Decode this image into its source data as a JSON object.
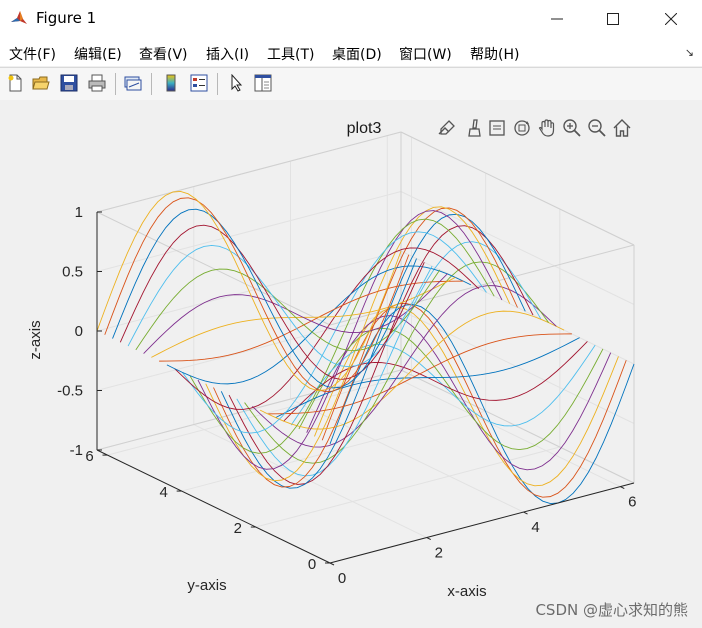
{
  "window": {
    "title": "Figure 1",
    "minimize_icon": "minimize-icon",
    "maximize_icon": "maximize-icon",
    "close_icon": "close-icon"
  },
  "menu": {
    "items": [
      "文件(F)",
      "编辑(E)",
      "查看(V)",
      "插入(I)",
      "工具(T)",
      "桌面(D)",
      "窗口(W)",
      "帮助(H)"
    ]
  },
  "toolbar": {
    "icons": [
      "new-figure-icon",
      "open-file-icon",
      "save-icon",
      "print-icon",
      "link-plot-icon",
      "colorbar-icon",
      "legend-icon",
      "select-arrow-icon",
      "property-editor-icon"
    ]
  },
  "axes_toolbar": {
    "icons": [
      "data-tips-icon",
      "brush-icon",
      "export-icon",
      "rotate-3d-icon",
      "pan-icon",
      "zoom-in-icon",
      "zoom-out-icon",
      "home-icon"
    ]
  },
  "chart_data": {
    "type": "line",
    "title": "plot3",
    "xlabel": "x-axis",
    "ylabel": "y-axis",
    "zlabel": "z-axis",
    "function": "z = sin(x)·cos(y)",
    "xlim": [
      0,
      6.2832
    ],
    "ylim": [
      0,
      6.2832
    ],
    "zlim": [
      -1,
      1
    ],
    "x_ticks": [
      "0",
      "2",
      "4",
      "6"
    ],
    "y_ticks": [
      "0",
      "2",
      "4",
      "6"
    ],
    "z_ticks": [
      "-1",
      "-0.5",
      "0",
      "0.5",
      "1"
    ],
    "grid": true,
    "box": true,
    "view": "3d",
    "series_count": 31,
    "points_per_series": 41,
    "x_range_per_series": [
      0,
      6.2832
    ],
    "y_values": "31 evenly spaced values from 0 to 2π, one per series",
    "colors": [
      "#0072BD",
      "#D95319",
      "#EDB120",
      "#7E2F8E",
      "#77AC30",
      "#4DBEEE",
      "#A2142F"
    ]
  },
  "watermark": "CSDN @虚心求知的熊"
}
